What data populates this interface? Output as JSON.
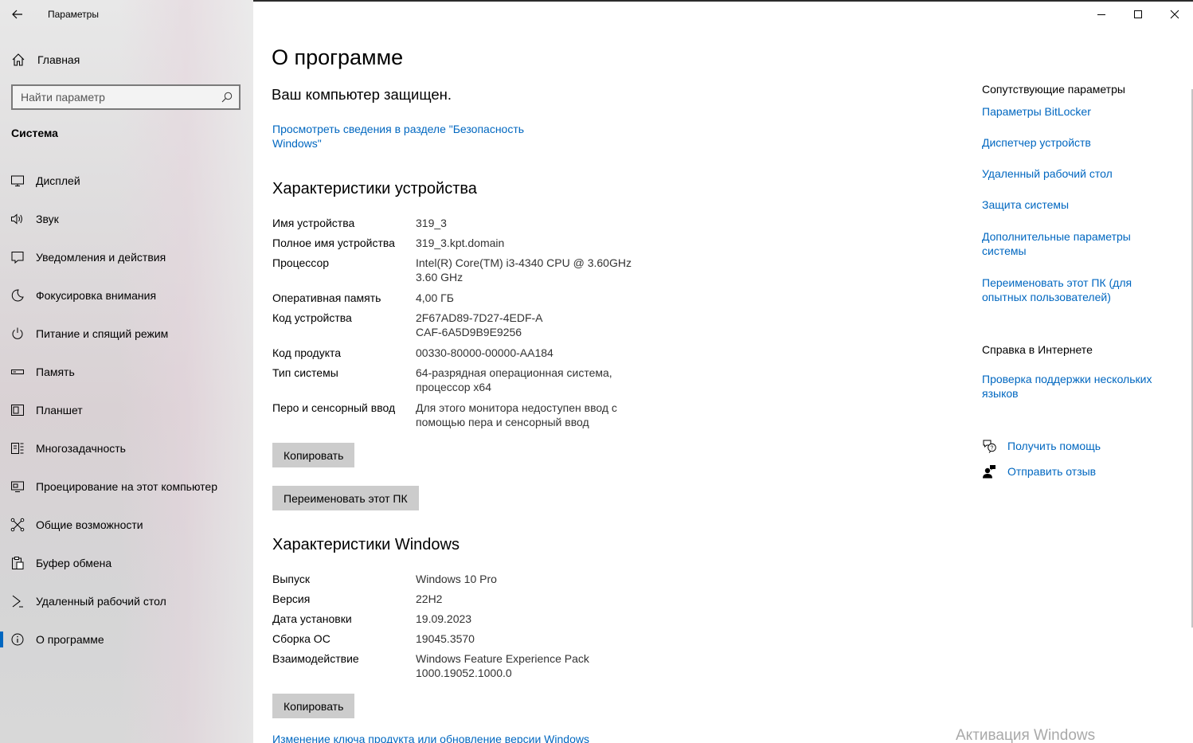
{
  "app": {
    "title": "Параметры"
  },
  "sidebar": {
    "home_label": "Главная",
    "search_placeholder": "Найти параметр",
    "section_title": "Система",
    "items": [
      {
        "label": "Дисплей",
        "icon": "display-icon"
      },
      {
        "label": "Звук",
        "icon": "sound-icon"
      },
      {
        "label": "Уведомления и действия",
        "icon": "notifications-icon"
      },
      {
        "label": "Фокусировка внимания",
        "icon": "moon-icon"
      },
      {
        "label": "Питание и спящий режим",
        "icon": "power-icon"
      },
      {
        "label": "Память",
        "icon": "storage-icon"
      },
      {
        "label": "Планшет",
        "icon": "tablet-icon"
      },
      {
        "label": "Многозадачность",
        "icon": "multitasking-icon"
      },
      {
        "label": "Проецирование на этот компьютер",
        "icon": "projecting-icon"
      },
      {
        "label": "Общие возможности",
        "icon": "shared-experiences-icon"
      },
      {
        "label": "Буфер обмена",
        "icon": "clipboard-icon"
      },
      {
        "label": "Удаленный рабочий стол",
        "icon": "remote-desktop-icon"
      },
      {
        "label": "О программе",
        "icon": "info-icon",
        "active": true
      }
    ]
  },
  "main": {
    "page_title": "О программе",
    "protected_text": "Ваш компьютер защищен.",
    "security_link": "Просмотреть сведения в разделе \"Безопасность Windows\"",
    "device_specs": {
      "heading": "Характеристики устройства",
      "rows": [
        {
          "key": "Имя устройства",
          "value": "319_3"
        },
        {
          "key": "Полное имя устройства",
          "value": "319_3.kpt.domain"
        },
        {
          "key": "Процессор",
          "value": "Intel(R) Core(TM) i3-4340 CPU @ 3.60GHz 3.60 GHz"
        },
        {
          "key": "Оперативная память",
          "value": "4,00 ГБ"
        },
        {
          "key": "Код устройства",
          "value": "2F67AD89-7D27-4EDF-ACAF-6A5D9B9E9256"
        },
        {
          "key": "Код продукта",
          "value": "00330-80000-00000-AA184"
        },
        {
          "key": "Тип системы",
          "value": "64-разрядная операционная система, процессор x64"
        },
        {
          "key": "Перо и сенсорный ввод",
          "value": "Для этого монитора недоступен ввод с помощью пера и сенсорный ввод"
        }
      ],
      "copy_label": "Копировать",
      "rename_label": "Переименовать этот ПК"
    },
    "windows_specs": {
      "heading": "Характеристики Windows",
      "rows": [
        {
          "key": "Выпуск",
          "value": "Windows 10 Pro"
        },
        {
          "key": "Версия",
          "value": "22H2"
        },
        {
          "key": "Дата установки",
          "value": "19.09.2023"
        },
        {
          "key": "Сборка ОС",
          "value": "19045.3570"
        },
        {
          "key": "Взаимодействие",
          "value": "Windows Feature Experience Pack 1000.19052.1000.0"
        }
      ],
      "copy_label": "Копировать"
    },
    "bottom_link": "Изменение ключа продукта или обновление версии Windows"
  },
  "related": {
    "heading": "Сопутствующие параметры",
    "links": [
      "Параметры BitLocker",
      "Диспетчер устройств",
      "Удаленный рабочий стол",
      "Защита системы",
      "Дополнительные параметры системы",
      "Переименовать этот ПК (для опытных пользователей)"
    ],
    "web_heading": "Справка в Интернете",
    "web_links": [
      "Проверка поддержки нескольких языков"
    ],
    "help_label": "Получить помощь",
    "feedback_label": "Отправить отзыв"
  },
  "watermark": "Активация Windows",
  "colors": {
    "accent": "#0067c0",
    "button": "#cccccc"
  }
}
